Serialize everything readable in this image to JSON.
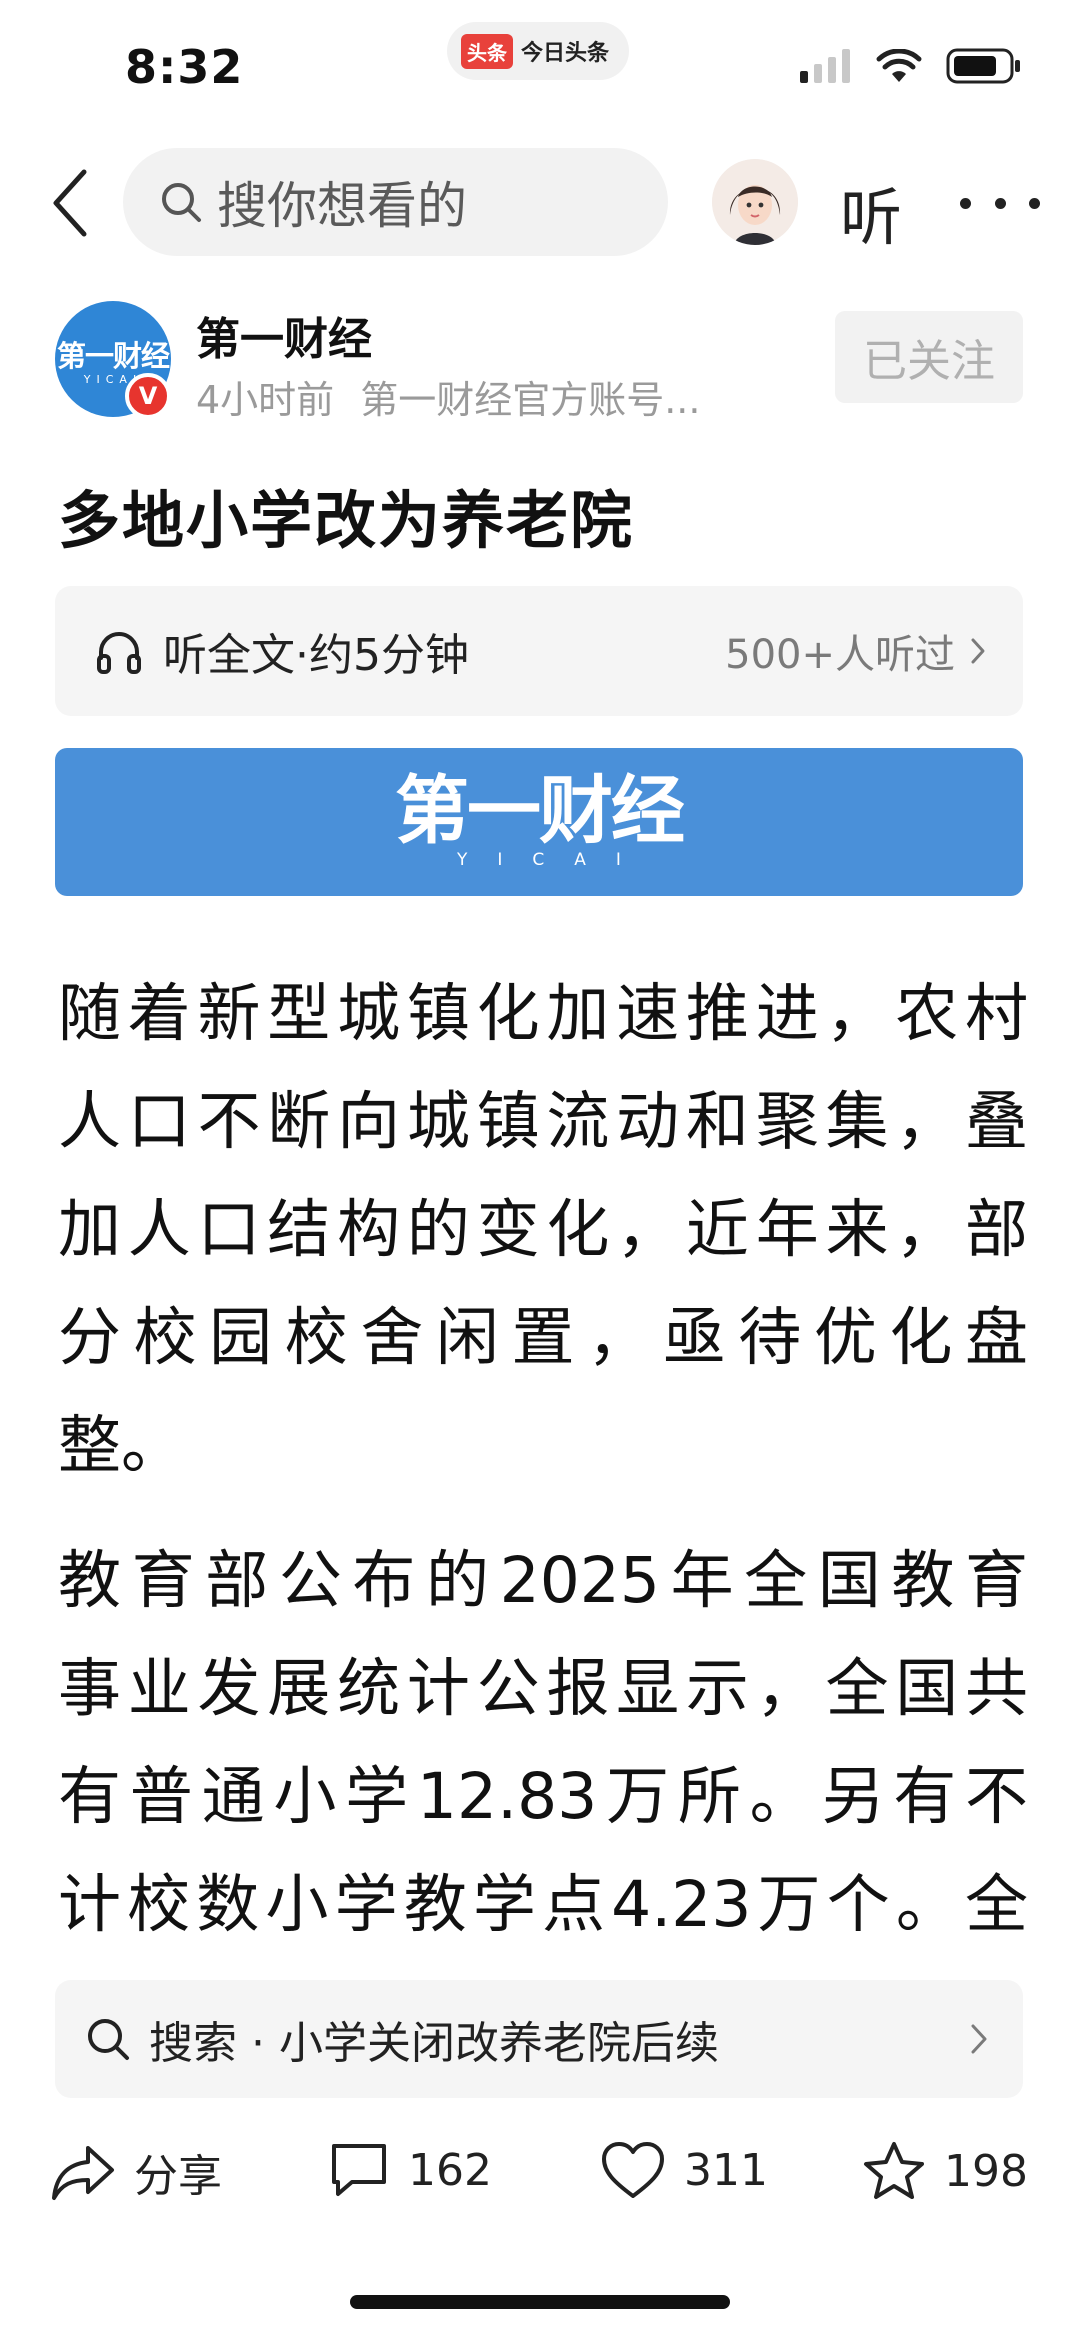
{
  "status_bar": {
    "time": "8:32",
    "app_badge": "头条",
    "app_name": "今日头条",
    "icons": [
      "signal-icon",
      "wifi-icon",
      "battery-icon"
    ]
  },
  "nav": {
    "back_icon": "chevron-left-icon",
    "search_placeholder": "搜你想看的",
    "listen_label": "听",
    "more_icon": "more-dots-icon"
  },
  "author": {
    "name": "第一财经",
    "logo_text": "第一财经",
    "logo_sub": "YICAI",
    "verified_mark": "V",
    "time_ago": "4小时前",
    "description": "第一财经官方账号...",
    "follow_label": "已关注"
  },
  "article": {
    "title": "多地小学改为养老院",
    "listen_bar": {
      "label": "听全文·约5分钟",
      "count": "500+人听过"
    },
    "banner": {
      "logo_text": "第一财经",
      "logo_sub": "YICAI"
    },
    "paragraph_1_lines": [
      "随着新型城镇化加速推进，农村",
      "人口不断向城镇流动和聚集，叠",
      "加人口结构的变化，近年来，部",
      "分校园校舍闲置，亟待优化盘",
      "整。"
    ],
    "paragraph_2_lines": [
      "教育部公布的2025年全国教育",
      "事业发展统计公报显示，全国共",
      "有普通小学12.83万所。另有不",
      "计校数小学教学点4.23万个。全"
    ]
  },
  "search_suggestion": {
    "label": "搜索 · 小学关闭改养老院后续"
  },
  "actions": {
    "share_label": "分享",
    "comment_count": "162",
    "like_count": "311",
    "favorite_count": "198"
  },
  "colors": {
    "brand_blue": "#4a90d9",
    "verified_red": "#e7342e",
    "muted_text": "#9a9a9a"
  }
}
